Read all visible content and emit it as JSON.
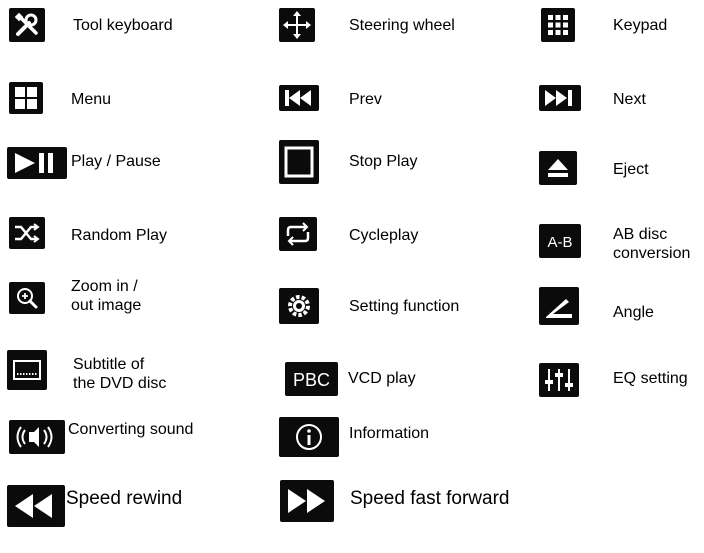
{
  "legend": {
    "tool_keyboard": "Tool keyboard",
    "steering_wheel": "Steering wheel",
    "keypad": "Keypad",
    "menu": "Menu",
    "prev": "Prev",
    "next": "Next",
    "play_pause": "Play / Pause",
    "stop_play": "Stop Play",
    "eject": "Eject",
    "random_play": "Random Play",
    "cycleplay": "Cycleplay",
    "ab_disc_conversion": "AB disc\nconversion",
    "zoom": "Zoom in /\nout image",
    "setting_function": "Setting function",
    "angle": "Angle",
    "subtitle": "Subtitle of\nthe DVD disc",
    "vcd_play": "VCD play",
    "eq_setting": "EQ setting",
    "converting_sound": "Converting sound",
    "information": "Information",
    "speed_rewind": "Speed rewind",
    "speed_fast_forward": "Speed fast forward"
  },
  "icon_text": {
    "ab": "A-B",
    "pbc": "PBC"
  },
  "icons": {
    "tool_keyboard": "tools-icon",
    "steering_wheel": "move-arrows-icon",
    "keypad": "keypad-grid-icon",
    "menu": "menu-grid-icon",
    "prev": "skip-previous-icon",
    "next": "skip-next-icon",
    "play_pause": "play-pause-icon",
    "stop_play": "stop-icon",
    "eject": "eject-icon",
    "random_play": "shuffle-icon",
    "cycleplay": "repeat-icon",
    "ab_disc_conversion": "ab-repeat-icon",
    "zoom": "zoom-icon",
    "setting_function": "gear-icon",
    "angle": "angle-icon",
    "subtitle": "subtitle-icon",
    "vcd_play": "pbc-icon",
    "eq_setting": "equalizer-icon",
    "converting_sound": "speaker-sound-icon",
    "information": "info-icon",
    "speed_rewind": "rewind-icon",
    "speed_fast_forward": "fast-forward-icon"
  },
  "colors": {
    "icon_bg": "#0b0b0b",
    "icon_fg": "#ffffff",
    "text": "#000000"
  }
}
